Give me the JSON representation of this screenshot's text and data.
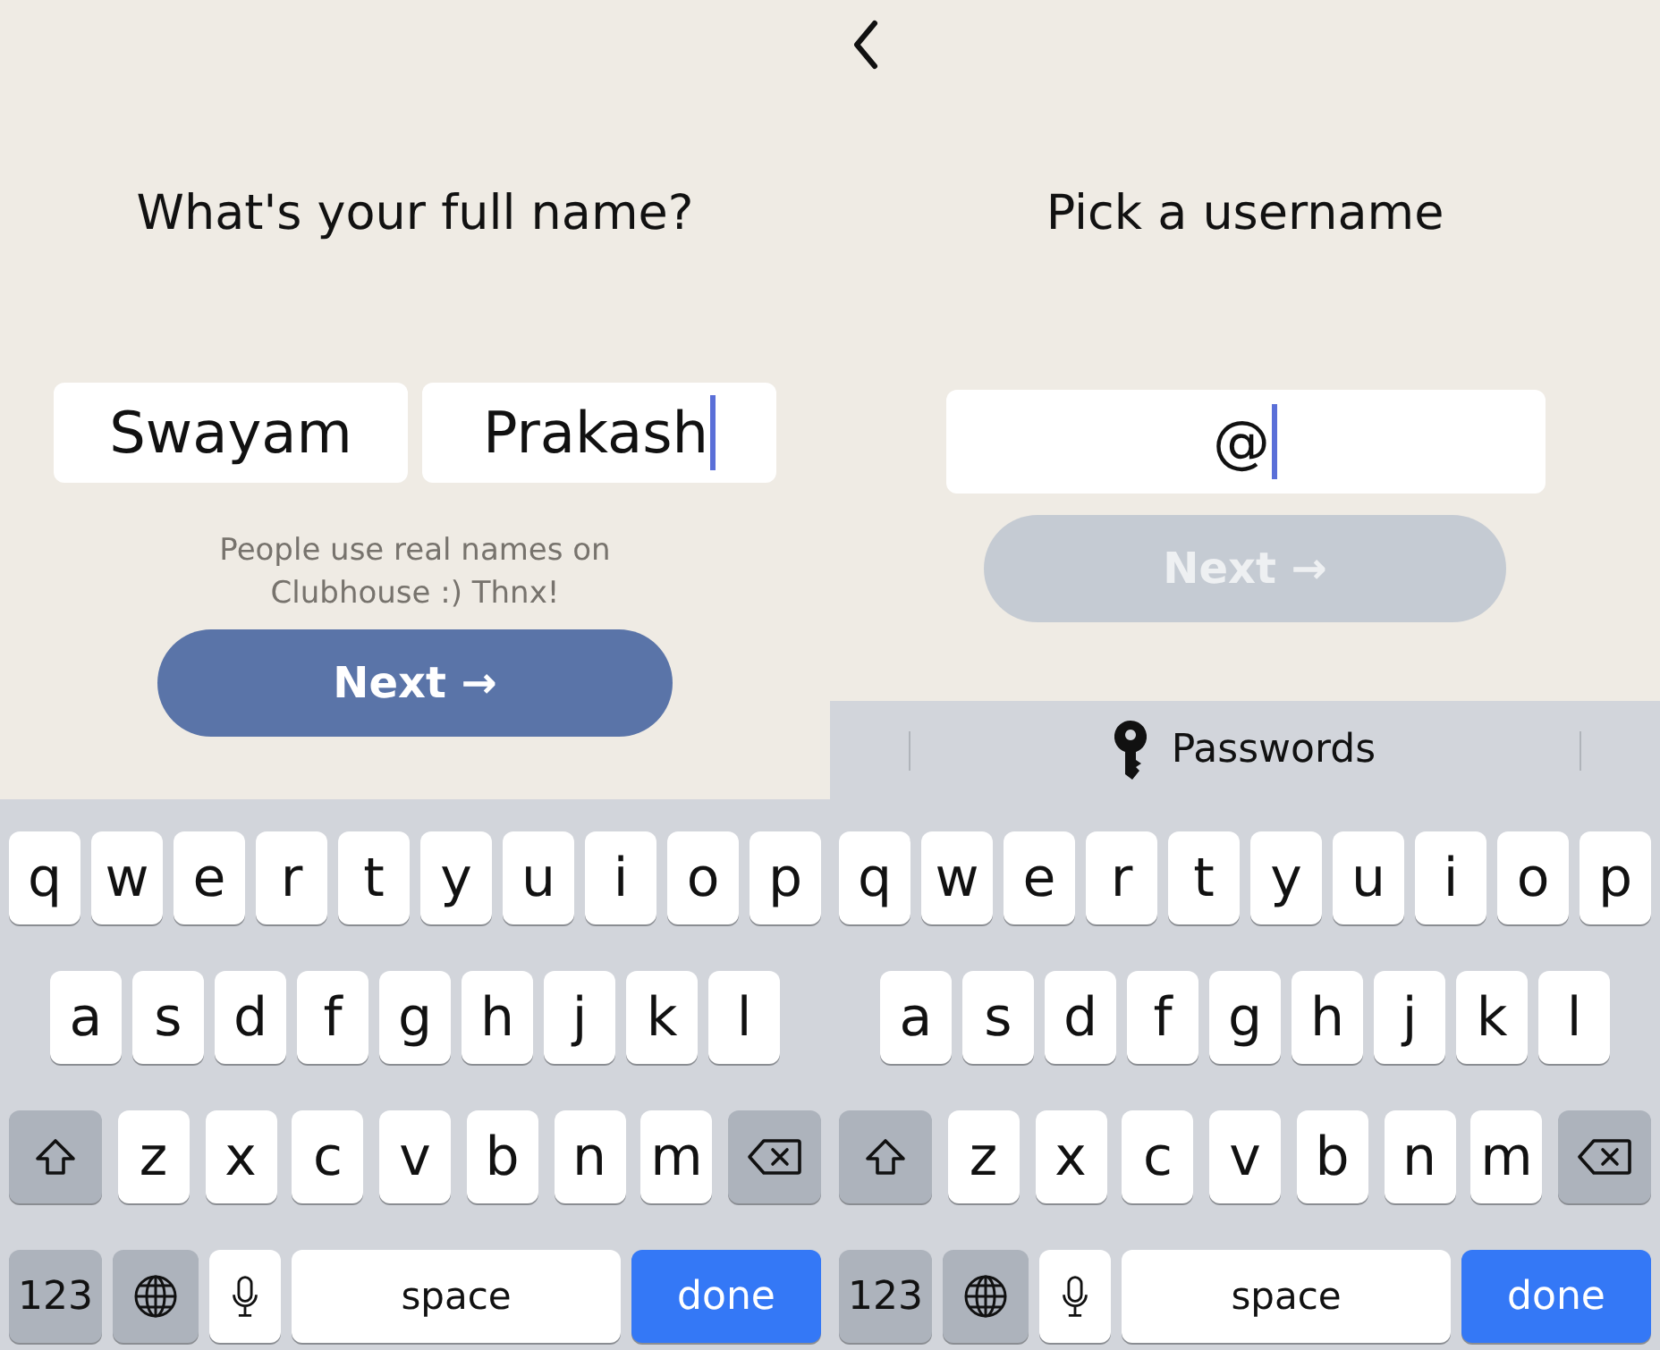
{
  "panels": [
    {
      "title": "What's your full name?",
      "fields": [
        {
          "value": "Swayam",
          "focused": false
        },
        {
          "value": "Prakash",
          "focused": true
        }
      ],
      "hint": "People use real names on Clubhouse :) Thnx!",
      "next": {
        "label": "Next →",
        "disabled": false
      },
      "keyboard": [
        [
          {
            "kind": "letter",
            "label": "q"
          },
          {
            "kind": "letter",
            "label": "w"
          },
          {
            "kind": "letter",
            "label": "e"
          },
          {
            "kind": "letter",
            "label": "r"
          },
          {
            "kind": "letter",
            "label": "t"
          },
          {
            "kind": "letter",
            "label": "y"
          },
          {
            "kind": "letter",
            "label": "u"
          },
          {
            "kind": "letter",
            "label": "i"
          },
          {
            "kind": "letter",
            "label": "o"
          },
          {
            "kind": "letter",
            "label": "p"
          }
        ],
        [
          {
            "kind": "letter",
            "label": "a"
          },
          {
            "kind": "letter",
            "label": "s"
          },
          {
            "kind": "letter",
            "label": "d"
          },
          {
            "kind": "letter",
            "label": "f"
          },
          {
            "kind": "letter",
            "label": "g"
          },
          {
            "kind": "letter",
            "label": "h"
          },
          {
            "kind": "letter",
            "label": "j"
          },
          {
            "kind": "letter",
            "label": "k"
          },
          {
            "kind": "letter",
            "label": "l"
          }
        ],
        [
          {
            "kind": "shift"
          },
          {
            "kind": "letter",
            "label": "z"
          },
          {
            "kind": "letter",
            "label": "x"
          },
          {
            "kind": "letter",
            "label": "c"
          },
          {
            "kind": "letter",
            "label": "v"
          },
          {
            "kind": "letter",
            "label": "b"
          },
          {
            "kind": "letter",
            "label": "n"
          },
          {
            "kind": "letter",
            "label": "m"
          },
          {
            "kind": "delete"
          }
        ],
        [
          {
            "kind": "numbers",
            "label": "123"
          },
          {
            "kind": "globe"
          },
          {
            "kind": "mic"
          },
          {
            "kind": "space",
            "label": "space"
          },
          {
            "kind": "done",
            "label": "done"
          }
        ]
      ]
    },
    {
      "back_button": true,
      "title": "Pick a username",
      "fields": [
        {
          "value": "@",
          "focused": true
        }
      ],
      "next": {
        "label": "Next →",
        "disabled": true
      },
      "suggestion_bar": {
        "label": "Passwords"
      },
      "keyboard": [
        [
          {
            "kind": "letter",
            "label": "q"
          },
          {
            "kind": "letter",
            "label": "w"
          },
          {
            "kind": "letter",
            "label": "e"
          },
          {
            "kind": "letter",
            "label": "r"
          },
          {
            "kind": "letter",
            "label": "t"
          },
          {
            "kind": "letter",
            "label": "y"
          },
          {
            "kind": "letter",
            "label": "u"
          },
          {
            "kind": "letter",
            "label": "i"
          },
          {
            "kind": "letter",
            "label": "o"
          },
          {
            "kind": "letter",
            "label": "p"
          }
        ],
        [
          {
            "kind": "letter",
            "label": "a"
          },
          {
            "kind": "letter",
            "label": "s"
          },
          {
            "kind": "letter",
            "label": "d"
          },
          {
            "kind": "letter",
            "label": "f"
          },
          {
            "kind": "letter",
            "label": "g"
          },
          {
            "kind": "letter",
            "label": "h"
          },
          {
            "kind": "letter",
            "label": "j"
          },
          {
            "kind": "letter",
            "label": "k"
          },
          {
            "kind": "letter",
            "label": "l"
          }
        ],
        [
          {
            "kind": "shift"
          },
          {
            "kind": "letter",
            "label": "z"
          },
          {
            "kind": "letter",
            "label": "x"
          },
          {
            "kind": "letter",
            "label": "c"
          },
          {
            "kind": "letter",
            "label": "v"
          },
          {
            "kind": "letter",
            "label": "b"
          },
          {
            "kind": "letter",
            "label": "n"
          },
          {
            "kind": "letter",
            "label": "m"
          },
          {
            "kind": "delete"
          }
        ],
        [
          {
            "kind": "numbers",
            "label": "123"
          },
          {
            "kind": "globe"
          },
          {
            "kind": "mic"
          },
          {
            "kind": "space",
            "label": "space"
          },
          {
            "kind": "done",
            "label": "done"
          }
        ]
      ]
    }
  ]
}
